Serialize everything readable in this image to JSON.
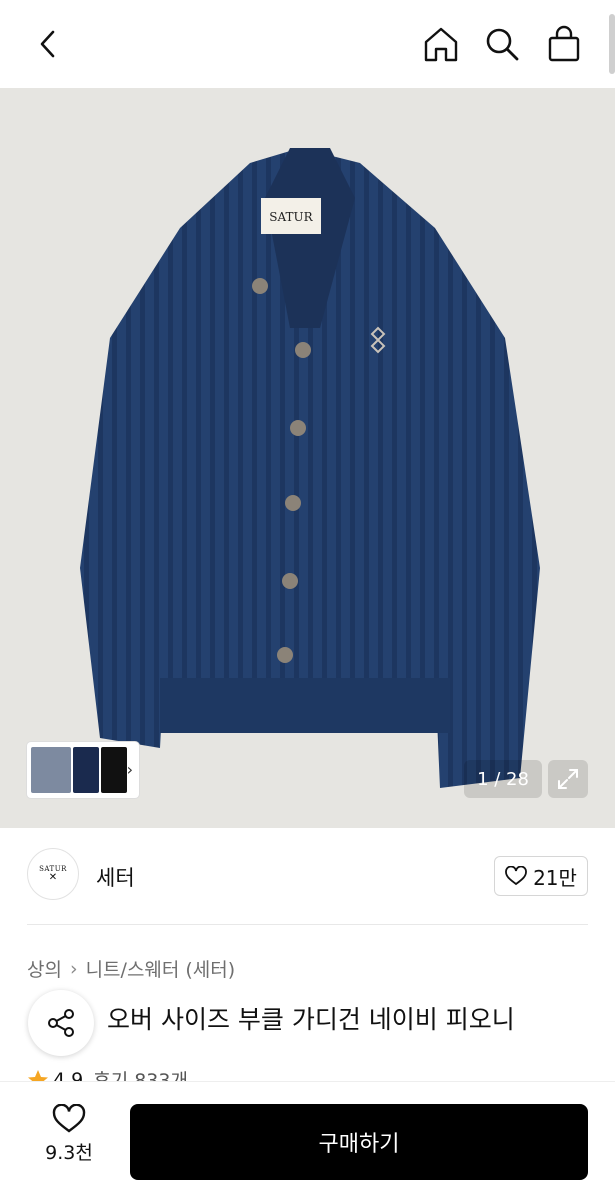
{
  "header": {
    "back_icon": "chevron-left-icon",
    "home_icon": "home-icon",
    "search_icon": "search-icon",
    "cart_icon": "shopping-bag-icon"
  },
  "gallery": {
    "counter": "1 / 28",
    "expand_icon": "expand-icon",
    "thumb_chevron": "›",
    "product_label_text": "SATUR"
  },
  "brand": {
    "logo_text": "SATUR",
    "name": "세터",
    "likes": "21만"
  },
  "breadcrumb": {
    "level1": "상의",
    "level2": "니트/스웨터",
    "level3": "(세터)"
  },
  "product": {
    "title": "오버 사이즈 부클 가디건 네이비 피오니",
    "rating": "4.9",
    "reviews": "후기 833개"
  },
  "bottom": {
    "wish_count": "9.3천",
    "buy_label": "구매하기"
  },
  "colors": {
    "buy_button": "#000000",
    "hero_bg": "#e6e5e1",
    "cardigan": "#23406e",
    "star": "#f5a623"
  }
}
